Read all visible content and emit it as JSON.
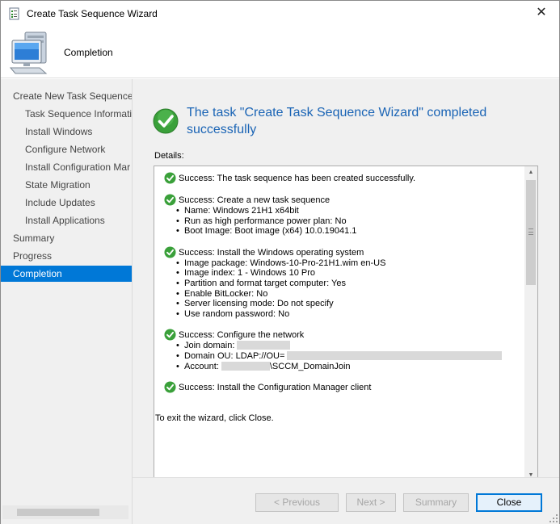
{
  "window": {
    "title": "Create Task Sequence Wizard",
    "close_glyph": "✕"
  },
  "header": {
    "title": "Completion"
  },
  "nav": {
    "items": [
      {
        "label": "Create New Task Sequence",
        "level": "top"
      },
      {
        "label": "Task Sequence Informati",
        "level": "sub"
      },
      {
        "label": "Install Windows",
        "level": "sub"
      },
      {
        "label": "Configure Network",
        "level": "sub"
      },
      {
        "label": "Install Configuration Mar",
        "level": "sub"
      },
      {
        "label": "State Migration",
        "level": "sub"
      },
      {
        "label": "Include Updates",
        "level": "sub"
      },
      {
        "label": "Install Applications",
        "level": "sub"
      },
      {
        "label": "Summary",
        "level": "top"
      },
      {
        "label": "Progress",
        "level": "top"
      },
      {
        "label": "Completion",
        "level": "top",
        "active": true
      }
    ]
  },
  "main": {
    "completion_message": "The task \"Create Task Sequence Wizard\" completed successfully",
    "details_label": "Details:",
    "exit_text": "To exit the wizard, click Close."
  },
  "details": {
    "blocks": [
      {
        "head": "Success: The task sequence has been created successfully.",
        "bullets": []
      },
      {
        "head": "Success: Create a new task sequence",
        "bullets": [
          "Name: Windows 21H1 x64bit",
          "Run as high performance power plan: No",
          "Boot Image: Boot image (x64) 10.0.19041.1"
        ]
      },
      {
        "head": "Success: Install the Windows operating system",
        "bullets": [
          "Image package: Windows-10-Pro-21H1.wim  en-US",
          "Image index: 1 - Windows 10 Pro",
          "Partition and format target computer: Yes",
          "Enable BitLocker: No",
          "Server licensing mode: Do not specify",
          "Use random password: No"
        ]
      },
      {
        "head": "Success: Configure the network",
        "bullets": [
          "Join domain:",
          "Domain OU: LDAP://OU=",
          "Account:"
        ],
        "account_suffix": "\\SCCM_DomainJoin"
      },
      {
        "head": "Success: Install the Configuration Manager client",
        "bullets": []
      }
    ]
  },
  "buttons": {
    "previous": "< Previous",
    "next": "Next >",
    "summary": "Summary",
    "close": "Close"
  },
  "colors": {
    "accent": "#0078d7",
    "success_green": "#3aa03a",
    "heading_blue": "#1a64b5"
  }
}
